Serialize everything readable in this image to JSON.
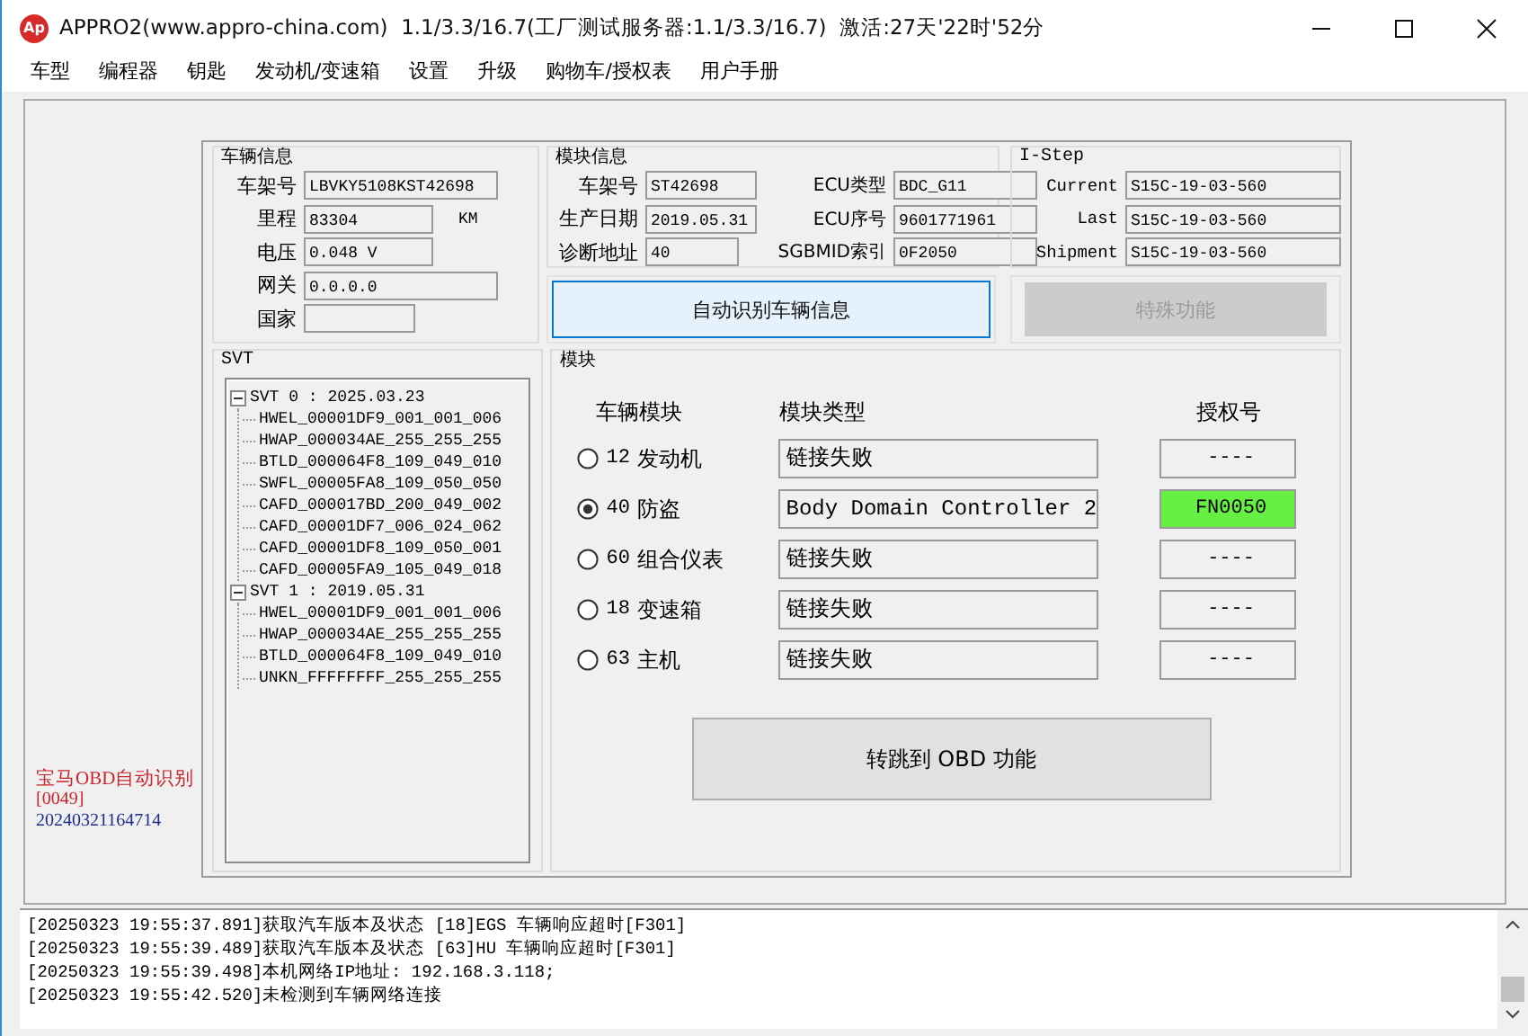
{
  "window": {
    "icon_text": "Ap",
    "title": "APPRO2(www.appro-china.com)  1.1/3.3/16.7(工厂测试服务器:1.1/3.3/16.7)  激活:27天'22时'52分"
  },
  "menu": [
    "车型",
    "编程器",
    "钥匙",
    "发动机/变速箱",
    "设置",
    "升级",
    "购物车/授权表",
    "用户手册"
  ],
  "side": {
    "label": "宝马OBD自动识别",
    "code": "[0049]",
    "serial": "20240321164714"
  },
  "vehicle_info": {
    "title": "车辆信息",
    "fields": [
      {
        "label": "车架号",
        "value": "LBVKY5108KST42698"
      },
      {
        "label": "里程",
        "value": "83304",
        "unit": "KM"
      },
      {
        "label": "电压",
        "value": "0.048 V"
      },
      {
        "label": "网关",
        "value": "0.0.0.0"
      },
      {
        "label": "国家"
      }
    ]
  },
  "module_info": {
    "title": "模块信息",
    "fields": [
      {
        "label": "车架号",
        "value": "ST42698"
      },
      {
        "label": "ECU类型",
        "value": "BDC_G11"
      },
      {
        "label": "生产日期",
        "value": "2019.05.31"
      },
      {
        "label": "ECU序号",
        "value": "9601771961"
      },
      {
        "label": "诊断地址",
        "value": "40"
      },
      {
        "label": "SGBMID索引",
        "value": "0F2050"
      }
    ]
  },
  "istep": {
    "title": "I-Step",
    "fields": [
      {
        "label": "Current",
        "value": "S15C-19-03-560"
      },
      {
        "label": "Last",
        "value": "S15C-19-03-560"
      },
      {
        "label": "Shipment",
        "value": "S15C-19-03-560"
      }
    ]
  },
  "auto_identify_button": {
    "label": "自动识别车辆信息"
  },
  "special_button": {
    "label": "特殊功能",
    "disabled": true
  },
  "svt": {
    "title": "SVT",
    "tree": [
      {
        "label": "SVT 0 : 2025.03.23",
        "expanded": true,
        "children": [
          {
            "label": "HWEL_00001DF9_001_001_006"
          },
          {
            "label": "HWAP_000034AE_255_255_255"
          },
          {
            "label": "BTLD_000064F8_109_049_010"
          },
          {
            "label": "SWFL_00005FA8_109_050_050"
          },
          {
            "label": "CAFD_000017BD_200_049_002"
          },
          {
            "label": "CAFD_00001DF7_006_024_062"
          },
          {
            "label": "CAFD_00001DF8_109_050_001"
          },
          {
            "label": "CAFD_00005FA9_105_049_018"
          }
        ]
      },
      {
        "label": "SVT 1 : 2019.05.31",
        "expanded": true,
        "children": [
          {
            "label": "HWEL_00001DF9_001_001_006"
          },
          {
            "label": "HWAP_000034AE_255_255_255"
          },
          {
            "label": "BTLD_000064F8_109_049_010"
          },
          {
            "label": "UNKN_FFFFFFFF_255_255_255"
          }
        ]
      }
    ]
  },
  "modules": {
    "title": "模块",
    "headers": [
      "车辆模块",
      "模块类型",
      "授权号"
    ],
    "rows": [
      {
        "code": "12",
        "name": "发动机",
        "type": "链接失败",
        "auth": "----",
        "selected": false,
        "authorized": false
      },
      {
        "code": "40",
        "name": "防盗",
        "type": "Body Domain Controller 2",
        "auth": "FN0050",
        "selected": true,
        "authorized": true
      },
      {
        "code": "60",
        "name": "组合仪表",
        "type": "链接失败",
        "auth": "----",
        "selected": false,
        "authorized": false
      },
      {
        "code": "18",
        "name": "变速箱",
        "type": "链接失败",
        "auth": "----",
        "selected": false,
        "authorized": false
      },
      {
        "code": "63",
        "name": "主机",
        "type": "链接失败",
        "auth": "----",
        "selected": false,
        "authorized": false
      }
    ],
    "obd_button": {
      "label": "转跳到 OBD 功能"
    }
  },
  "log": [
    "[20250323 19:55:37.891]获取汽车版本及状态 [18]EGS 车辆响应超时[F301]",
    "[20250323 19:55:39.489]获取汽车版本及状态 [63]HU 车辆响应超时[F301]",
    "[20250323 19:55:39.498]本机网络IP地址: 192.168.3.118;",
    "[20250323 19:55:42.520]未检测到车辆网络连接"
  ]
}
